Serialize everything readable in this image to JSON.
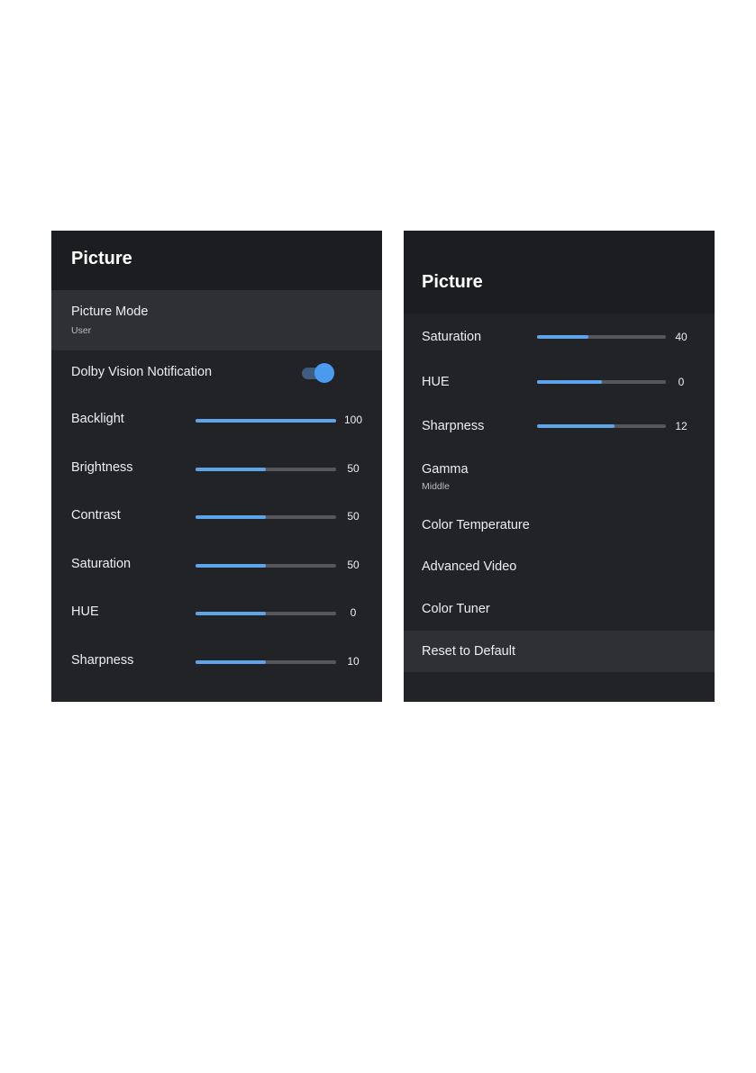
{
  "left_panel": {
    "title": "Picture",
    "picture_mode": {
      "label": "Picture Mode",
      "value": "User"
    },
    "dolby": {
      "label": "Dolby Vision Notification",
      "enabled": true
    },
    "sliders": [
      {
        "label": "Backlight",
        "value": "100",
        "fraction": 1.0
      },
      {
        "label": "Brightness",
        "value": "50",
        "fraction": 0.5
      },
      {
        "label": "Contrast",
        "value": "50",
        "fraction": 0.5
      },
      {
        "label": "Saturation",
        "value": "50",
        "fraction": 0.5
      },
      {
        "label": "HUE",
        "value": "0",
        "fraction": 0.5
      },
      {
        "label": "Sharpness",
        "value": "10",
        "fraction": 0.5
      }
    ]
  },
  "right_panel": {
    "title": "Picture",
    "sliders": [
      {
        "label": "Saturation",
        "value": "40",
        "fraction": 0.4
      },
      {
        "label": "HUE",
        "value": "0",
        "fraction": 0.5
      },
      {
        "label": "Sharpness",
        "value": "12",
        "fraction": 0.6
      }
    ],
    "gamma": {
      "label": "Gamma",
      "value": "Middle"
    },
    "items": [
      {
        "label": "Color Temperature"
      },
      {
        "label": "Advanced Video"
      },
      {
        "label": "Color Tuner"
      },
      {
        "label": "Reset to Default"
      }
    ]
  },
  "colors": {
    "panel_bg": "#222326",
    "title_bg": "#1c1d20",
    "highlight_bg": "#2f3034",
    "slider_fill": "#5ea4ea",
    "slider_track": "#54575c",
    "toggle_on": "#4a9bf0"
  }
}
